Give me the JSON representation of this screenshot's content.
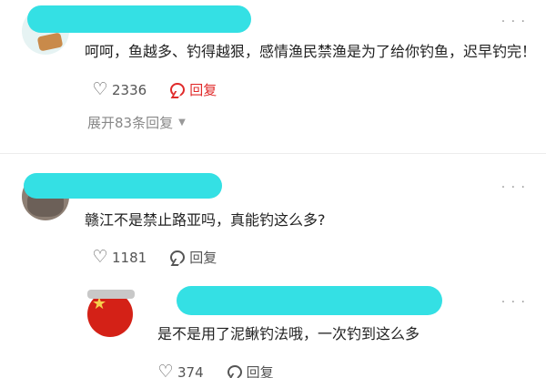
{
  "comments": [
    {
      "text": "呵呵，鱼越多、钓得越狠，感情渔民禁渔是为了给你钓鱼，迟早钓完！",
      "likes": "2336",
      "reply_label": "回复",
      "expand_label": "展开83条回复",
      "more": "· · ·"
    },
    {
      "text": "赣江不是禁止路亚吗，真能钓这么多?",
      "likes": "1181",
      "reply_label": "回复",
      "more": "· · ·"
    },
    {
      "text": "是不是用了泥鳅钓法哦，一次钓到这么多",
      "likes": "374",
      "reply_label": "回复",
      "more": "· · ·"
    }
  ],
  "icons": {
    "like": "heart-outline-icon",
    "reply": "comment-bubble-icon",
    "expand": "chevron-down-icon",
    "more": "more-dots-icon"
  },
  "colors": {
    "reply_highlight": "#e02a2a",
    "redaction": "#34e0e4"
  }
}
